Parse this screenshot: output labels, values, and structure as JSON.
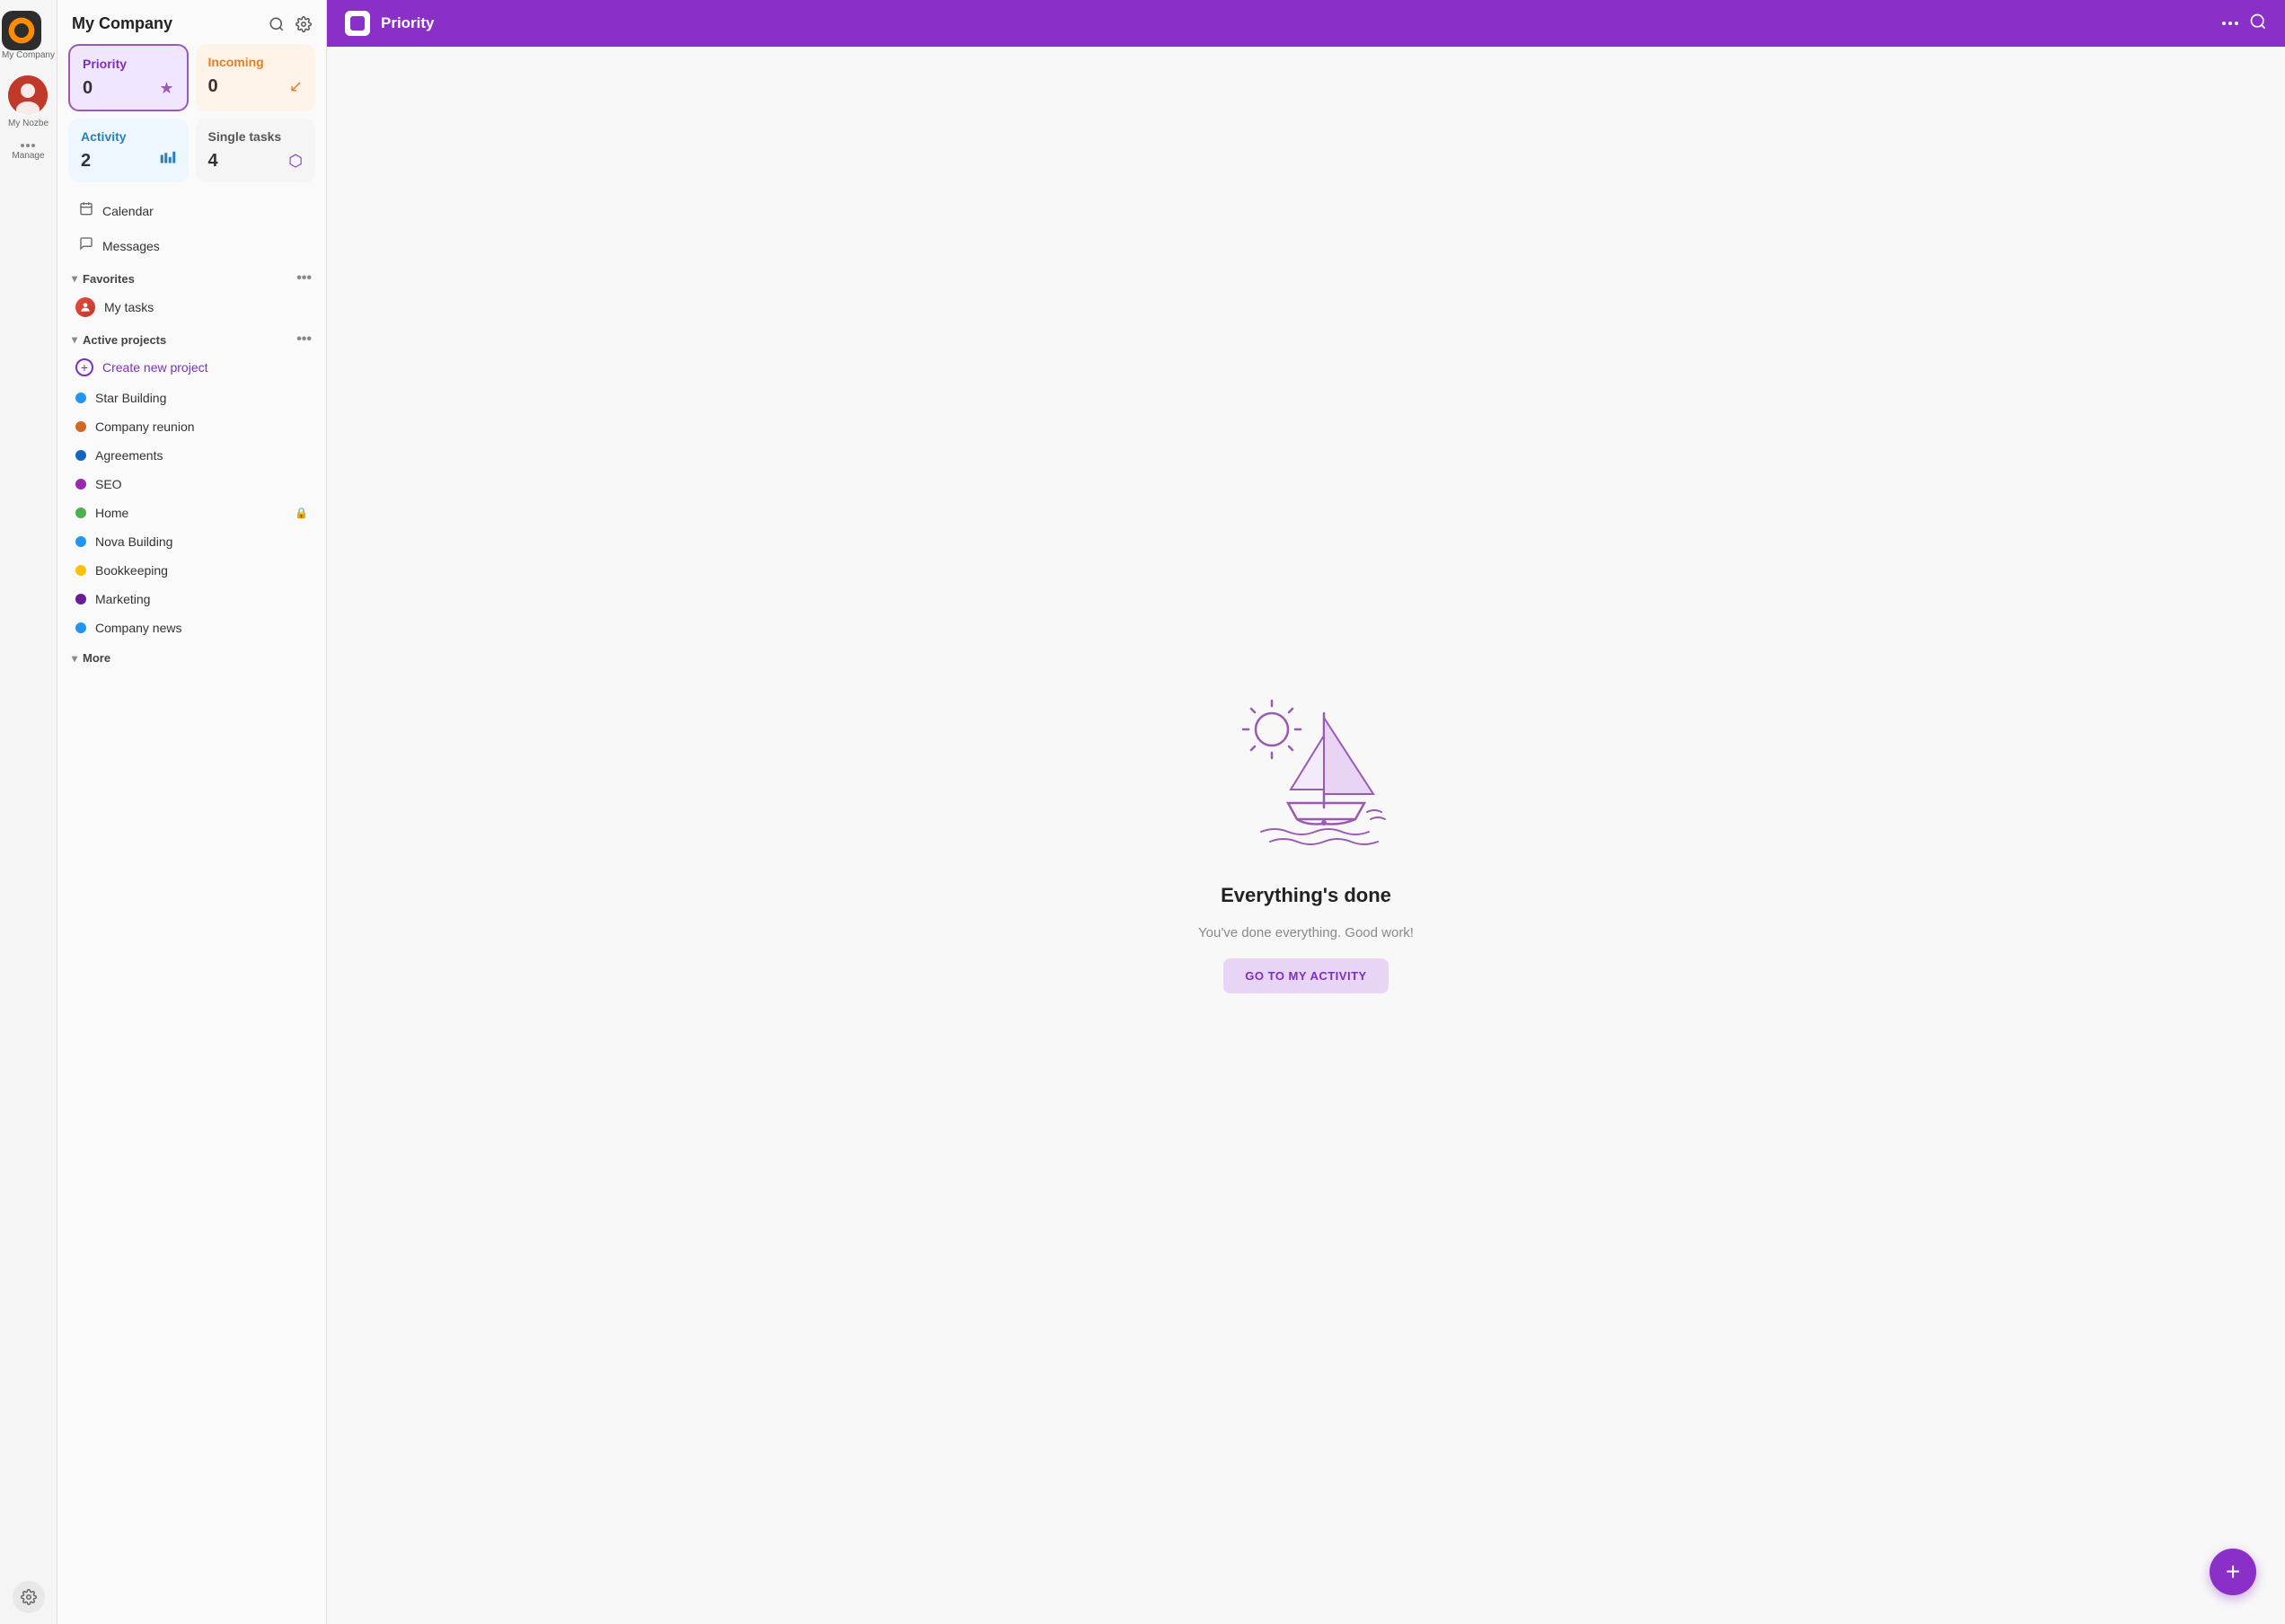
{
  "iconBar": {
    "companyName": "My Company",
    "userName": "My Nozbe",
    "manageLabel": "Manage"
  },
  "sidebar": {
    "title": "My Company",
    "searchLabel": "Search",
    "settingsLabel": "Settings",
    "cards": [
      {
        "id": "priority",
        "label": "Priority",
        "count": "0",
        "icon": "★"
      },
      {
        "id": "incoming",
        "label": "Incoming",
        "count": "0",
        "icon": "↓"
      },
      {
        "id": "activity",
        "label": "Activity",
        "count": "2",
        "icon": "📶"
      },
      {
        "id": "single",
        "label": "Single tasks",
        "count": "4",
        "icon": "⬡"
      }
    ],
    "navItems": [
      {
        "id": "calendar",
        "label": "Calendar",
        "icon": "📅"
      },
      {
        "id": "messages",
        "label": "Messages",
        "icon": "💬"
      }
    ],
    "favoritesSection": {
      "label": "Favorites",
      "items": [
        {
          "id": "my-tasks",
          "label": "My tasks",
          "hasAvatar": true
        }
      ]
    },
    "activeProjectsSection": {
      "label": "Active projects",
      "createLabel": "Create new project",
      "projects": [
        {
          "id": "star-building",
          "label": "Star Building",
          "color": "#2196F3",
          "locked": false
        },
        {
          "id": "company-reunion",
          "label": "Company reunion",
          "color": "#D2691E",
          "locked": false
        },
        {
          "id": "agreements",
          "label": "Agreements",
          "color": "#1565C0",
          "locked": false
        },
        {
          "id": "seo",
          "label": "SEO",
          "color": "#9C27B0",
          "locked": false
        },
        {
          "id": "home",
          "label": "Home",
          "color": "#4CAF50",
          "locked": true
        },
        {
          "id": "nova-building",
          "label": "Nova Building",
          "color": "#2196F3",
          "locked": false
        },
        {
          "id": "bookkeeping",
          "label": "Bookkeeping",
          "color": "#FFC107",
          "locked": false
        },
        {
          "id": "marketing",
          "label": "Marketing",
          "color": "#6A1B9A",
          "locked": false
        },
        {
          "id": "company-news",
          "label": "Company news",
          "color": "#2196F3",
          "locked": false
        }
      ]
    },
    "moreSection": {
      "label": "More"
    }
  },
  "mainHeader": {
    "title": "Priority",
    "dotsLabel": "More options",
    "searchLabel": "Search"
  },
  "emptyState": {
    "title": "Everything's done",
    "subtitle": "You've done everything. Good work!",
    "buttonLabel": "GO TO MY ACTIVITY"
  },
  "fab": {
    "label": "+"
  }
}
